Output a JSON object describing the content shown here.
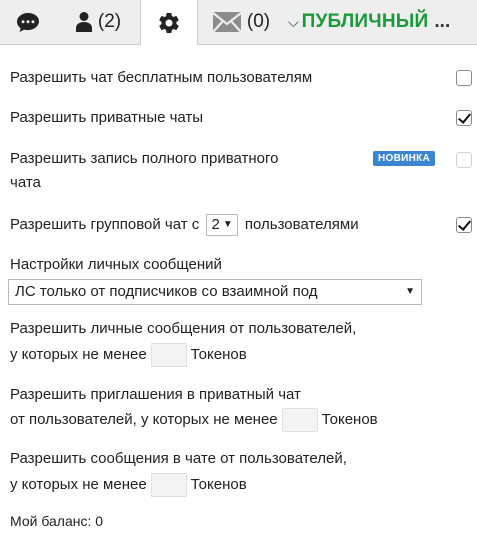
{
  "tabs": {
    "users_count": "(2)",
    "pm_count": "(0)",
    "mode_label": "ПУБЛИЧНЫЙ",
    "mode_dots": "..."
  },
  "settings": {
    "free_chat_label": "Разрешить чат бесплатным пользователям",
    "private_chat_label": "Разрешить приватные чаты",
    "record_line1": "Разрешить запись полного приватного",
    "record_line2": "чата",
    "record_badge": "НОВИНКА",
    "group_prefix": "Разрешить групповой чат с",
    "group_value": "2",
    "group_suffix": "пользователями",
    "pm_settings_label": "Настройки личных сообщений",
    "pm_select_value": "ЛС только от подписчиков со взаимной под",
    "pm_from_line1": "Разрешить личные сообщения от пользователей,",
    "pm_from_line2a": "у которых не менее",
    "tokens_label": "Токенов",
    "invite_line1": "Разрешить приглашения в приватный чат",
    "invite_line2a": "от пользователей, у которых не менее",
    "chatmsg_line1": "Разрешить сообщения в чате от пользователей,",
    "chatmsg_line2a": "у которых не менее",
    "balance": "Мой баланс: 0"
  },
  "checkbox_states": {
    "free_chat": false,
    "private_chat": true,
    "record": false,
    "group_chat": true
  }
}
